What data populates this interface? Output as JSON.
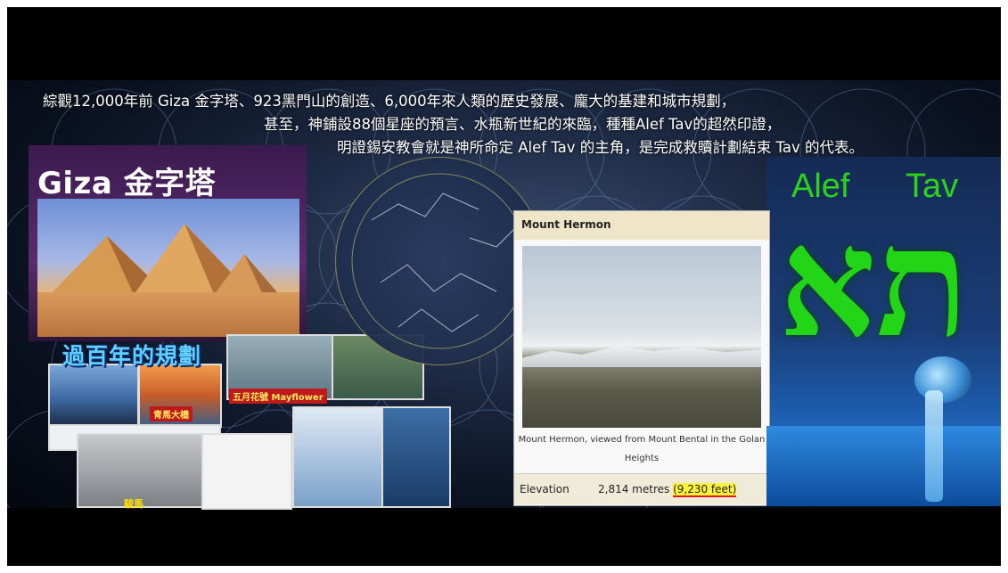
{
  "headline": {
    "line1": "綜觀12,000年前 Giza 金字塔、923黑門山的創造、6,000年來人類的歷史發展、龐大的基建和城市規劃，",
    "line2": "甚至，神鋪設88個星座的預言、水瓶新世紀的來臨，種種Alef Tav的超然印證，",
    "line3": "明證錫安教會就是神所命定 Alef Tav 的主角，是完成救贖計劃結束 Tav 的代表。"
  },
  "giza": {
    "title": "Giza 金字塔"
  },
  "centennial": {
    "title": "過百年的規劃",
    "label_mayflower": "五月花號 Mayflower",
    "label_bridge": "青馬大橋",
    "label_horse": "駿馬"
  },
  "hermon": {
    "title": "Mount Hermon",
    "caption": "Mount Hermon, viewed from Mount Bental in the Golan Heights",
    "elevation_label": "Elevation",
    "elevation_metres": "2,814 metres",
    "elevation_feet": "(9,230 feet)"
  },
  "alef_tav": {
    "word1": "Alef",
    "word2": "Tav",
    "hebrew": "תא"
  },
  "colors": {
    "accent_green": "#22d516",
    "highlight_yellow": "#fff23b",
    "cyan_title": "#5fd0ff"
  }
}
